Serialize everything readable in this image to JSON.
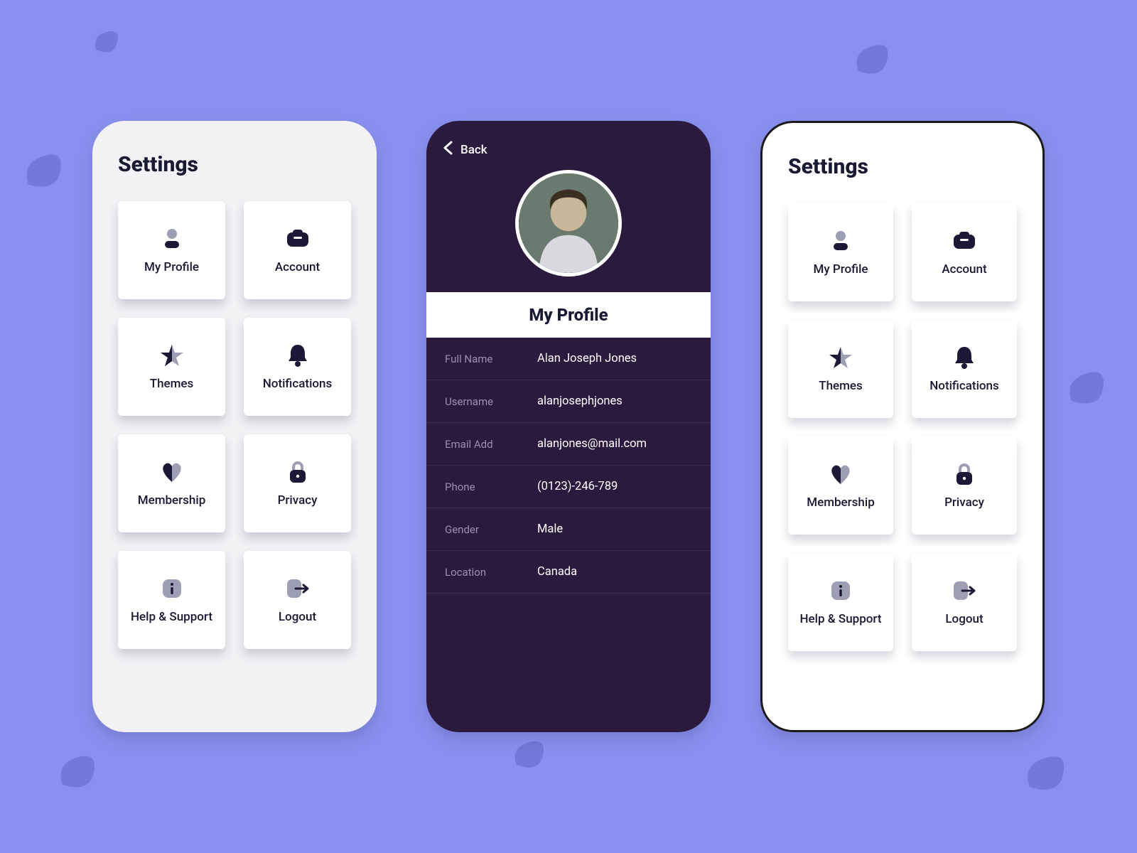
{
  "settings": {
    "title": "Settings",
    "tiles": [
      {
        "label": "My Profile",
        "icon": "person-icon"
      },
      {
        "label": "Account",
        "icon": "folder-icon"
      },
      {
        "label": "Themes",
        "icon": "star-icon"
      },
      {
        "label": "Notifications",
        "icon": "bell-icon"
      },
      {
        "label": "Membership",
        "icon": "heart-icon"
      },
      {
        "label": "Privacy",
        "icon": "lock-icon"
      },
      {
        "label": "Help & Support",
        "icon": "info-icon"
      },
      {
        "label": "Logout",
        "icon": "logout-icon"
      }
    ]
  },
  "profile": {
    "back_label": "Back",
    "section_title": "My Profile",
    "fields": [
      {
        "k": "Full Name",
        "v": "Alan Joseph Jones"
      },
      {
        "k": "Username",
        "v": "alanjosephjones"
      },
      {
        "k": "Email Add",
        "v": "alanjones@mail.com"
      },
      {
        "k": "Phone",
        "v": "(0123)-246-789"
      },
      {
        "k": "Gender",
        "v": "Male"
      },
      {
        "k": "Location",
        "v": "Canada"
      }
    ]
  },
  "colors": {
    "background": "#8a90ef",
    "dark_panel": "#2a1a3e",
    "text_dark": "#191933",
    "muted_icon": "#9d9db3"
  }
}
